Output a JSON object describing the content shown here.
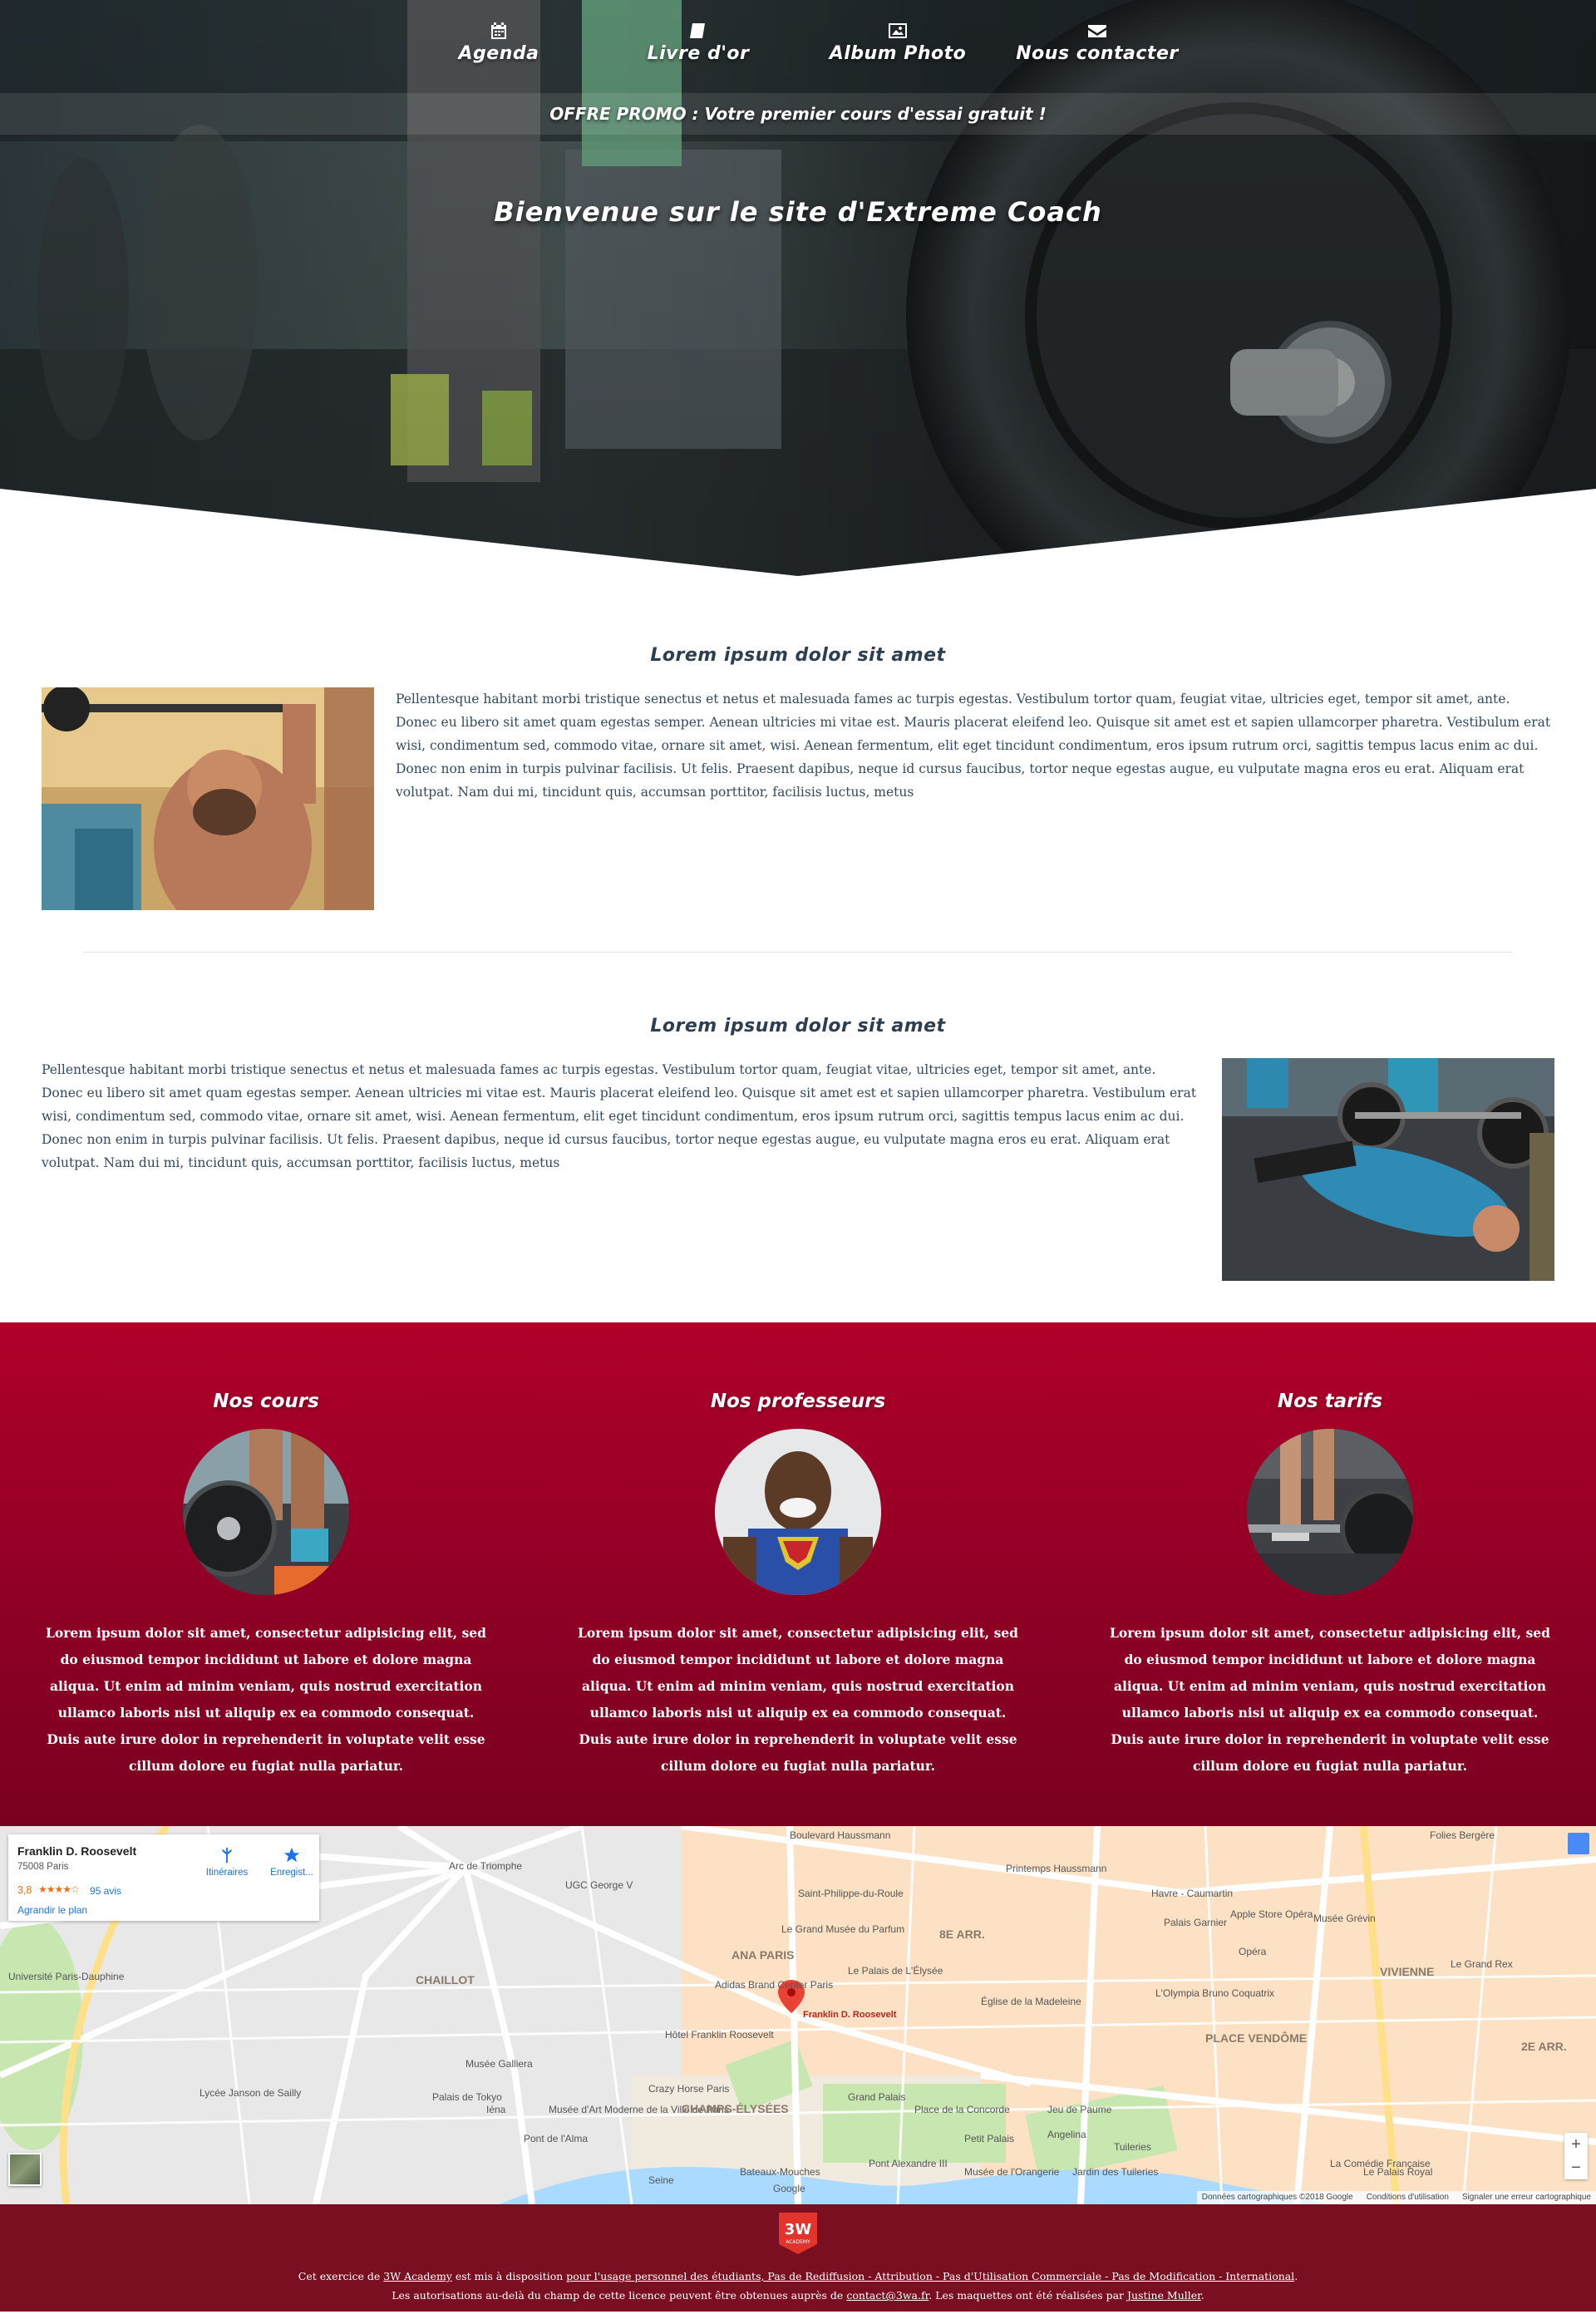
{
  "nav": {
    "items": [
      {
        "label": "Agenda",
        "icon": "calendar-icon"
      },
      {
        "label": "Livre d'or",
        "icon": "book-icon"
      },
      {
        "label": "Album Photo",
        "icon": "picture-icon"
      },
      {
        "label": "Nous contacter",
        "icon": "envelope-icon"
      }
    ]
  },
  "promo": "OFFRE PROMO : Votre premier cours d'essai gratuit !",
  "hero_title": "Bienvenue sur le site d'Extreme Coach",
  "sections": [
    {
      "title": "Lorem ipsum dolor sit amet",
      "text": "Pellentesque habitant morbi tristique senectus et netus et malesuada fames ac turpis egestas. Vestibulum tortor quam, feugiat vitae, ultricies eget, tempor sit amet, ante. Donec eu libero sit amet quam egestas semper. Aenean ultricies mi vitae est. Mauris placerat eleifend leo. Quisque sit amet est et sapien ullamcorper pharetra. Vestibulum erat wisi, condimentum sed, commodo vitae, ornare sit amet, wisi. Aenean fermentum, elit eget tincidunt condimentum, eros ipsum rutrum orci, sagittis tempus lacus enim ac dui. Donec non enim in turpis pulvinar facilisis. Ut felis. Praesent dapibus, neque id cursus faucibus, tortor neque egestas augue, eu vulputate magna eros eu erat. Aliquam erat volutpat. Nam dui mi, tincidunt quis, accumsan porttitor, facilisis luctus, metus"
    },
    {
      "title": "Lorem ipsum dolor sit amet",
      "text": "Pellentesque habitant morbi tristique senectus et netus et malesuada fames ac turpis egestas. Vestibulum tortor quam, feugiat vitae, ultricies eget, tempor sit amet, ante. Donec eu libero sit amet quam egestas semper. Aenean ultricies mi vitae est. Mauris placerat eleifend leo. Quisque sit amet est et sapien ullamcorper pharetra. Vestibulum erat wisi, condimentum sed, commodo vitae, ornare sit amet, wisi. Aenean fermentum, elit eget tincidunt condimentum, eros ipsum rutrum orci, sagittis tempus lacus enim ac dui. Donec non enim in turpis pulvinar facilisis. Ut felis. Praesent dapibus, neque id cursus faucibus, tortor neque egestas augue, eu vulputate magna eros eu erat. Aliquam erat volutpat. Nam dui mi, tincidunt quis, accumsan porttitor, facilisis luctus, metus"
    }
  ],
  "features": [
    {
      "title": "Nos cours",
      "text": "Lorem ipsum dolor sit amet, consectetur adipisicing elit, sed do eiusmod tempor incididunt ut labore et dolore magna aliqua. Ut enim ad minim veniam, quis nostrud exercitation ullamco laboris nisi ut aliquip ex ea commodo consequat. Duis aute irure dolor in reprehenderit in voluptate velit esse cillum dolore eu fugiat nulla pariatur."
    },
    {
      "title": "Nos professeurs",
      "text": "Lorem ipsum dolor sit amet, consectetur adipisicing elit, sed do eiusmod tempor incididunt ut labore et dolore magna aliqua. Ut enim ad minim veniam, quis nostrud exercitation ullamco laboris nisi ut aliquip ex ea commodo consequat. Duis aute irure dolor in reprehenderit in voluptate velit esse cillum dolore eu fugiat nulla pariatur."
    },
    {
      "title": "Nos tarifs",
      "text": "Lorem ipsum dolor sit amet, consectetur adipisicing elit, sed do eiusmod tempor incididunt ut labore et dolore magna aliqua. Ut enim ad minim veniam, quis nostrud exercitation ullamco laboris nisi ut aliquip ex ea commodo consequat. Duis aute irure dolor in reprehenderit in voluptate velit esse cillum dolore eu fugiat nulla pariatur."
    }
  ],
  "map": {
    "place_name": "Franklin D. Roosevelt",
    "place_address": "75008 Paris",
    "rating": "3,8",
    "stars": "★★★★☆",
    "reviews": "95 avis",
    "enlarge": "Agrandir le plan",
    "directions": "Itinéraires",
    "save": "Enregist...",
    "zoom_in": "+",
    "zoom_out": "−",
    "marker_label": "Franklin D. Roosevelt",
    "labels": [
      "Arc de Triomphe",
      "CHAILLOT",
      "Musée Galliera",
      "Palais de Tokyo",
      "Musée d'Art Moderne de la Ville de Paris",
      "Pont de l'Alma",
      "Crazy Horse Paris",
      "CHAMPS-ÉLYSÉES",
      "Grand Palais",
      "Petit Palais",
      "Hôtel Franklin Roosevelt",
      "ANA PARIS",
      "Saint-Philippe-du-Roule",
      "Le Grand Musée du Parfum",
      "8E ARR.",
      "Le Palais de L'Élysée",
      "Église de la Madeleine",
      "Place de la Concorde",
      "Jeu de Paume",
      "Angelina",
      "Jardin des Tuileries",
      "Tuileries",
      "Musée de l'Orangerie",
      "PLACE VENDÔME",
      "L'Olympia Bruno Coquatrix",
      "Printemps Haussmann",
      "Havre - Caumartin",
      "Palais Garnier",
      "Apple Store Opéra",
      "Musée Grévin",
      "VIVIENNE",
      "Le Grand Rex",
      "2E ARR.",
      "Le Palais Royal",
      "Folies Bergère",
      "Pont Alexandre III",
      "Bateaux-Mouches",
      "Lycée Janson de Sailly",
      "Université Paris-Dauphine",
      "Iéna",
      "UGC George V",
      "Adidas Brand Center Paris",
      "Seine",
      "Boulevard Haussmann",
      "La Comédie Française",
      "Opéra",
      "Google"
    ],
    "attribution": "Données cartographiques ©2018 Google",
    "terms": "Conditions d'utilisation",
    "report": "Signaler une erreur cartographique"
  },
  "footer": {
    "logo_text": "3W",
    "logo_sub": "ACADEMY",
    "line1_pre": "Cet exercice de ",
    "line1_link1": "3W Academy",
    "line1_mid": " est mis à disposition ",
    "line1_link2": "pour l'usage personnel des étudiants, Pas de Rediffusion - Attribution - Pas d'Utilisation Commerciale - Pas de Modification - International",
    "line1_end": ".",
    "line2_pre": "Les autorisations au-delà du champ de cette licence peuvent être obtenues auprès de ",
    "line2_link1": "contact@3wa.fr",
    "line2_mid": ". Les maquettes ont été réalisées par ",
    "line2_link2": "Justine Muller",
    "line2_end": "."
  },
  "colors": {
    "accent": "#a0002a",
    "footer": "#7a0f22",
    "text": "#2c3e50"
  }
}
